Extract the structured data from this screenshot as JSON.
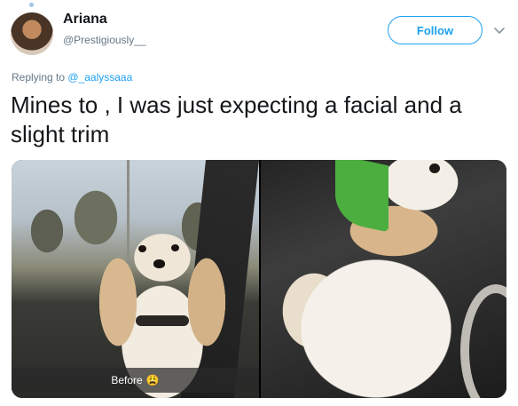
{
  "tweet": {
    "author": {
      "display_name": "Ariana",
      "handle": "@Prestigiously__"
    },
    "follow_label": "Follow",
    "reply_prefix": "Replying to",
    "reply_to": "@_aalyssaaa",
    "text": "Mines to , I was just expecting a facial and a slight trim",
    "media": {
      "left_caption": "Before",
      "left_caption_emoji": "😩"
    }
  },
  "colors": {
    "accent": "#1da1f2",
    "text": "#14171a",
    "muted": "#657786"
  },
  "icons": {
    "caret": "chevron-down-icon"
  }
}
